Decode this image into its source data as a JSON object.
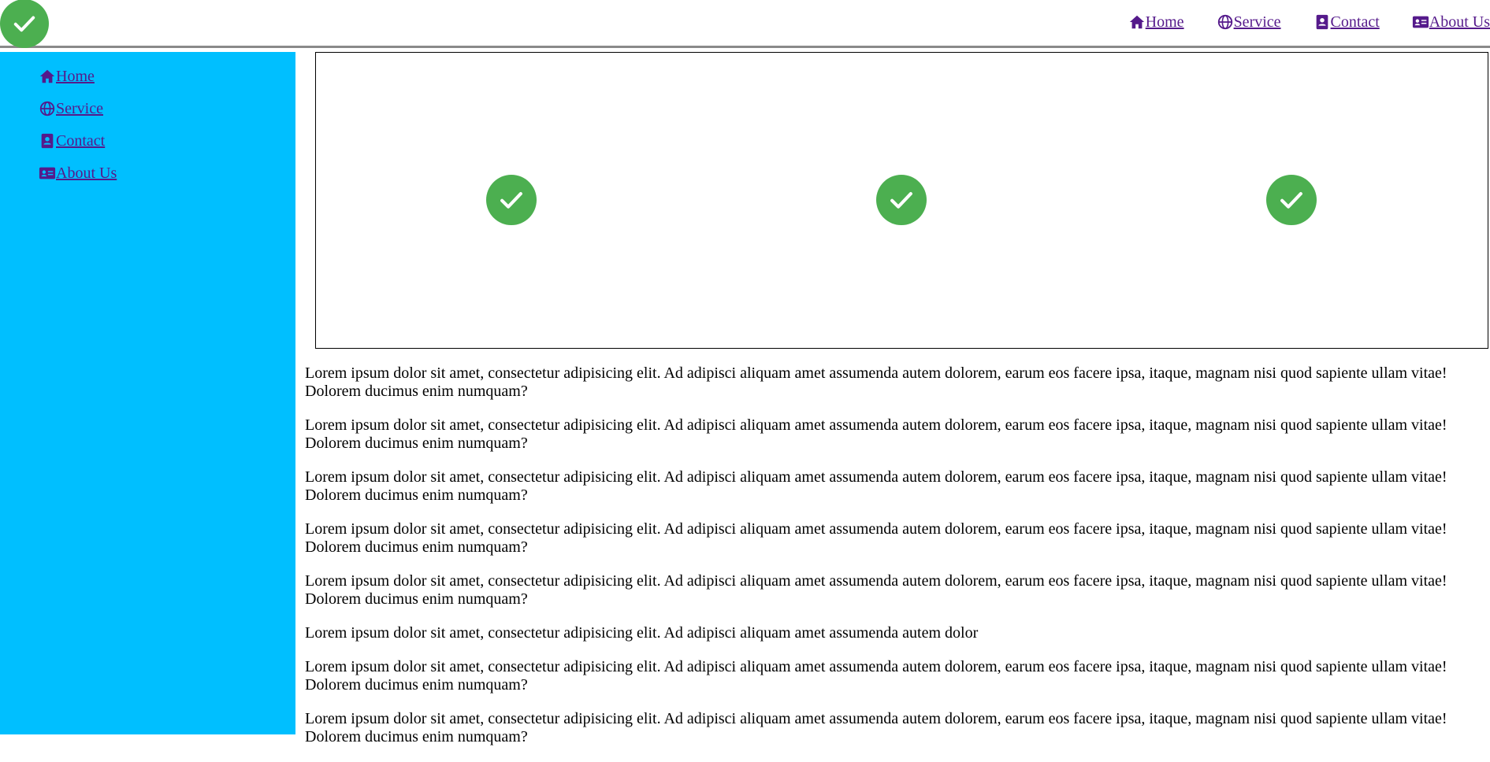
{
  "logo": {
    "icon": "check-icon",
    "color": "#4caf50"
  },
  "topnav": {
    "items": [
      {
        "label": "Home",
        "icon": "home-icon"
      },
      {
        "label": "Service",
        "icon": "globe-icon"
      },
      {
        "label": "Contact",
        "icon": "contact-card-icon"
      },
      {
        "label": "About Us",
        "icon": "id-card-icon"
      }
    ]
  },
  "sidebar": {
    "background": "#00bfff",
    "items": [
      {
        "label": "Home",
        "icon": "home-icon"
      },
      {
        "label": "Service",
        "icon": "globe-icon"
      },
      {
        "label": "Contact",
        "icon": "contact-card-icon"
      },
      {
        "label": "About Us",
        "icon": "id-card-icon"
      }
    ]
  },
  "slider": {
    "slides": [
      {
        "icon": "check-icon"
      },
      {
        "icon": "check-icon"
      },
      {
        "icon": "check-icon"
      }
    ]
  },
  "content": {
    "paragraphs": [
      "Lorem ipsum dolor sit amet, consectetur adipisicing elit. Ad adipisci aliquam amet assumenda autem dolorem, earum eos facere ipsa, itaque, magnam nisi quod sapiente ullam vitae! Dolorem ducimus enim numquam?",
      "Lorem ipsum dolor sit amet, consectetur adipisicing elit. Ad adipisci aliquam amet assumenda autem dolorem, earum eos facere ipsa, itaque, magnam nisi quod sapiente ullam vitae! Dolorem ducimus enim numquam?",
      "Lorem ipsum dolor sit amet, consectetur adipisicing elit. Ad adipisci aliquam amet assumenda autem dolorem, earum eos facere ipsa, itaque, magnam nisi quod sapiente ullam vitae! Dolorem ducimus enim numquam?",
      "Lorem ipsum dolor sit amet, consectetur adipisicing elit. Ad adipisci aliquam amet assumenda autem dolorem, earum eos facere ipsa, itaque, magnam nisi quod sapiente ullam vitae! Dolorem ducimus enim numquam?",
      "Lorem ipsum dolor sit amet, consectetur adipisicing elit. Ad adipisci aliquam amet assumenda autem dolorem, earum eos facere ipsa, itaque, magnam nisi quod sapiente ullam vitae! Dolorem ducimus enim numquam?",
      "Lorem ipsum dolor sit amet, consectetur adipisicing elit. Ad adipisci aliquam amet assumenda autem dolor",
      "Lorem ipsum dolor sit amet, consectetur adipisicing elit. Ad adipisci aliquam amet assumenda autem dolorem, earum eos facere ipsa, itaque, magnam nisi quod sapiente ullam vitae! Dolorem ducimus enim numquam?",
      "Lorem ipsum dolor sit amet, consectetur adipisicing elit. Ad adipisci aliquam amet assumenda autem dolorem, earum eos facere ipsa, itaque, magnam nisi quod sapiente ullam vitae! Dolorem ducimus enim numquam?"
    ]
  }
}
